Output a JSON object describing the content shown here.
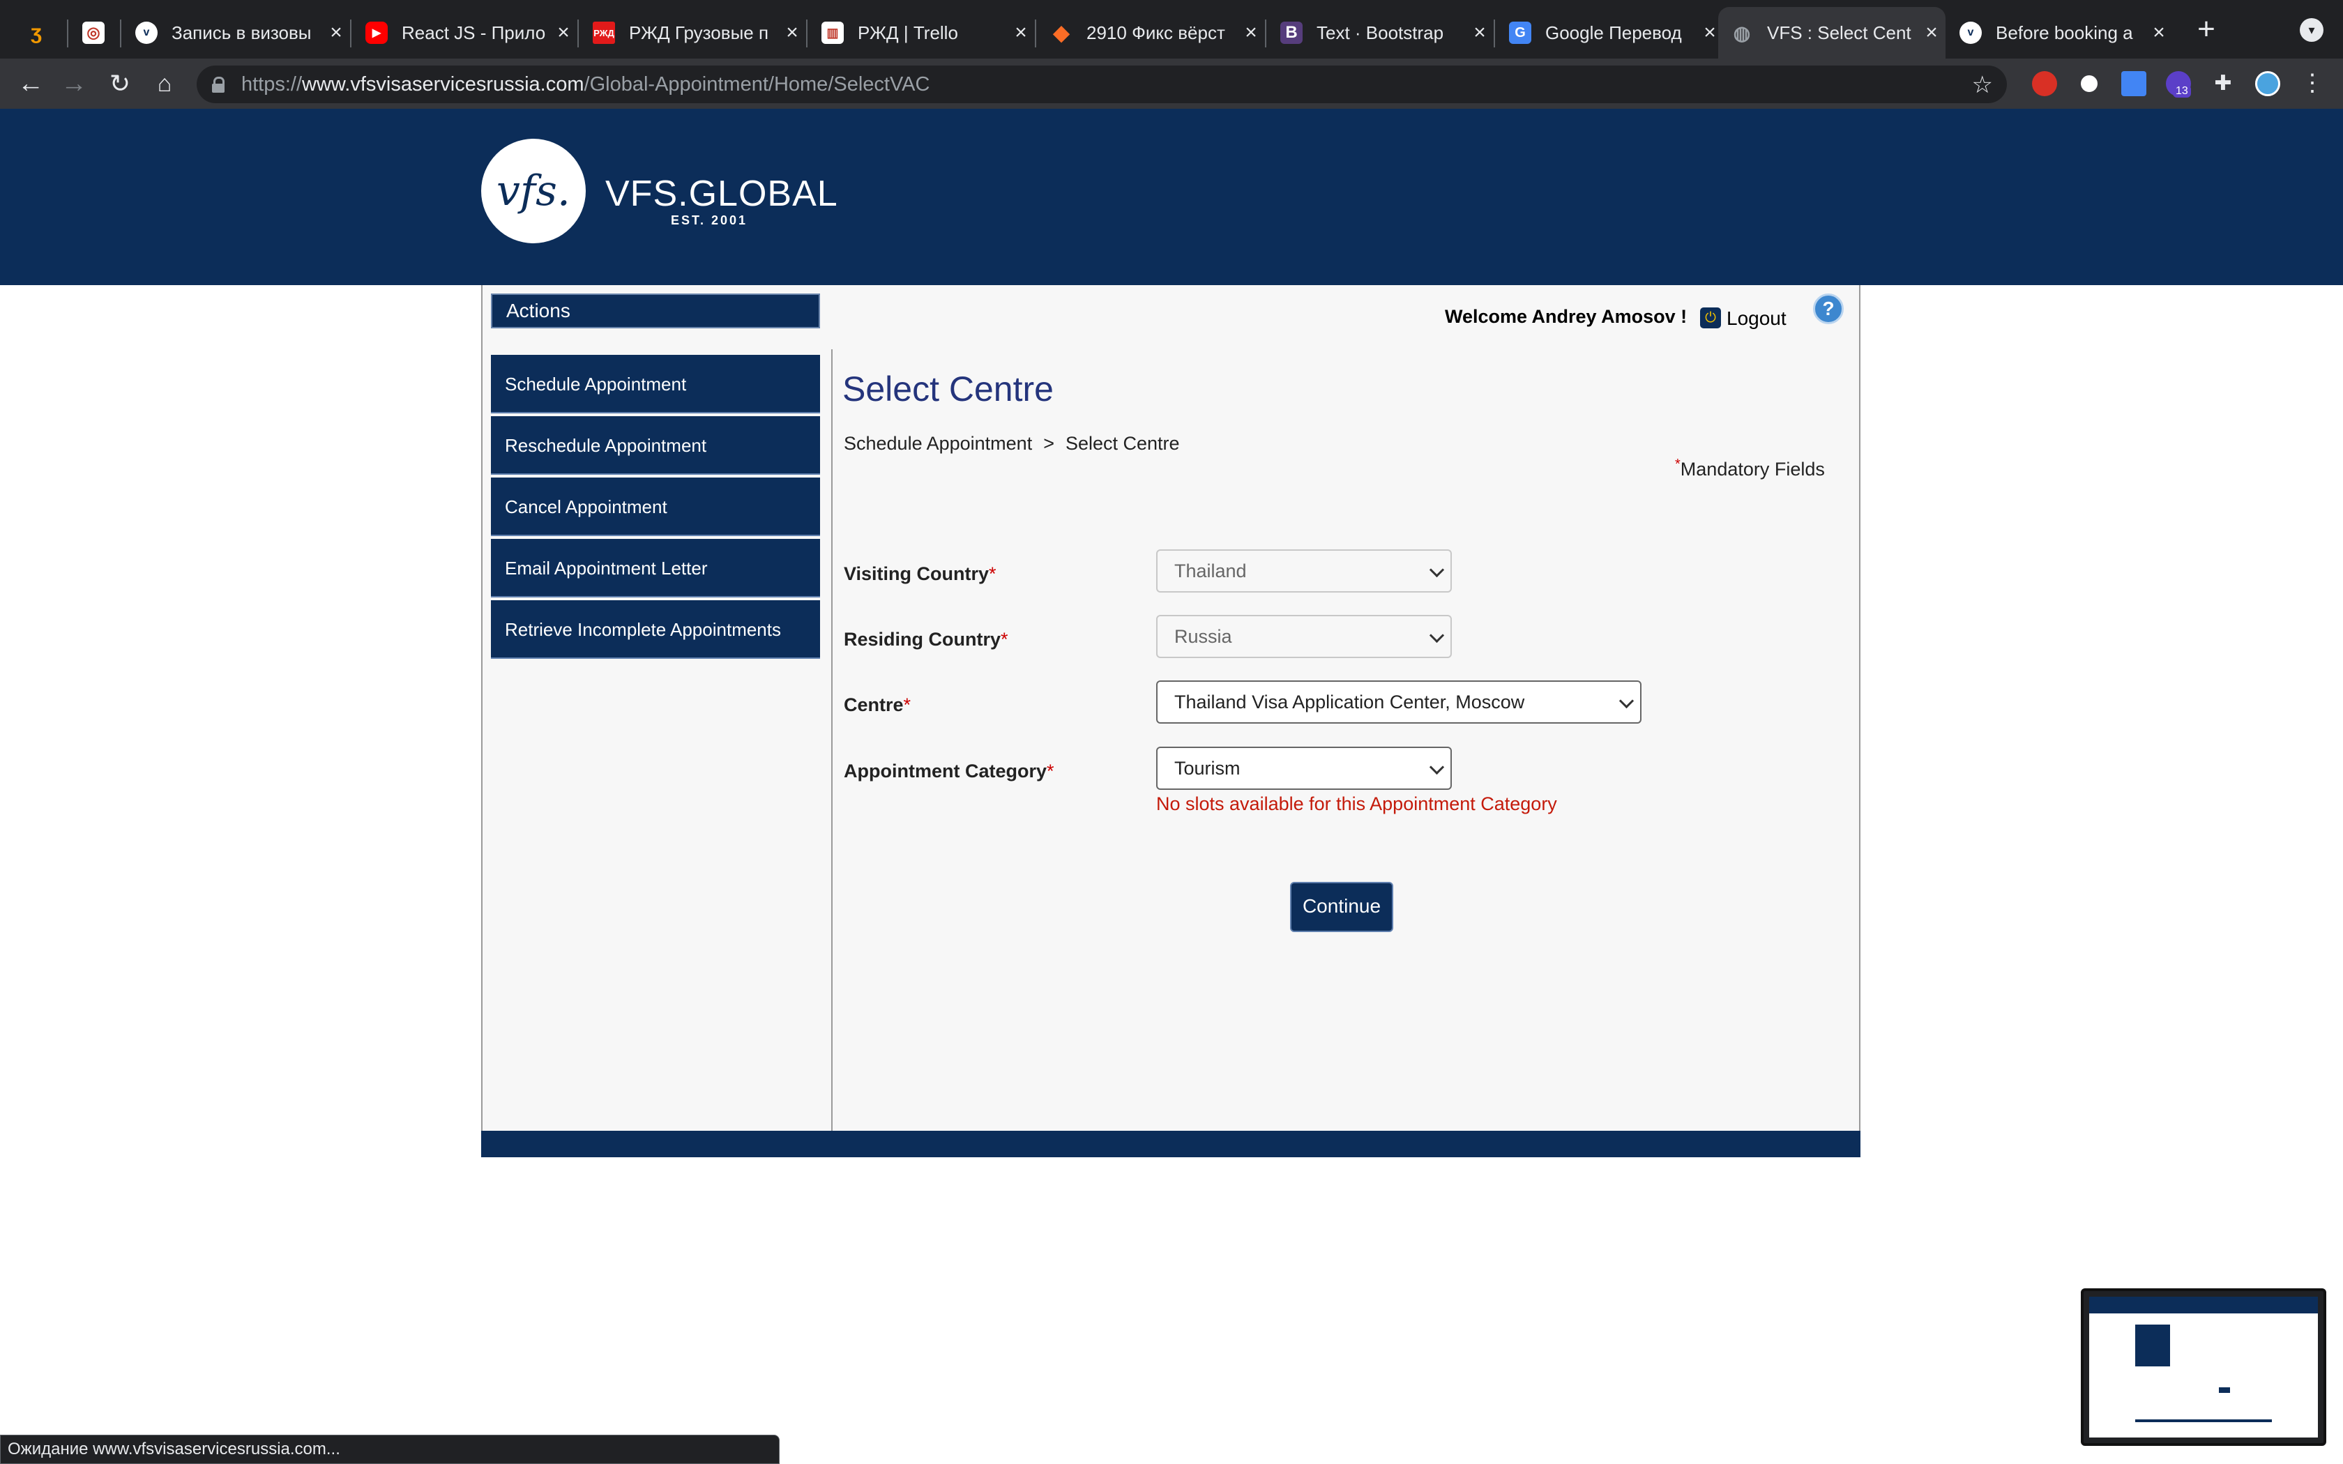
{
  "browser": {
    "tabs": [
      {
        "title": "",
        "icon": "app-icon"
      },
      {
        "title": "",
        "icon": "app-icon-2"
      },
      {
        "title": "Запись в визовы",
        "icon": "vfs-icon"
      },
      {
        "title": "React JS - Прило",
        "icon": "youtube-icon"
      },
      {
        "title": "РЖД Грузовые п",
        "icon": "rzd-icon"
      },
      {
        "title": "РЖД | Trello",
        "icon": "trello-icon"
      },
      {
        "title": "2910 Фикс вёрст",
        "icon": "gitlab-icon"
      },
      {
        "title": "Text · Bootstrap",
        "icon": "bootstrap-icon"
      },
      {
        "title": "Google Перевод",
        "icon": "google-translate-icon"
      },
      {
        "title": "VFS : Select Cent",
        "icon": "globe-icon"
      },
      {
        "title": "Before booking a",
        "icon": "vfs-icon"
      }
    ],
    "new_tab": "+",
    "url_prefix": "https://",
    "url_host": "www.vfsvisaservicesrussia.com",
    "url_path": "/Global-Appointment/Home/SelectVAC",
    "extension_badge": "13",
    "status_text": "Ожидание www.vfsvisaservicesrussia.com..."
  },
  "header": {
    "logo_mark": "vfs.",
    "logo_text": "VFS.GLOBAL",
    "logo_est": "EST. 2001"
  },
  "sidebar": {
    "actions_label": "Actions",
    "items": [
      {
        "label": "Schedule Appointment"
      },
      {
        "label": "Reschedule Appointment"
      },
      {
        "label": "Cancel Appointment"
      },
      {
        "label": "Email Appointment Letter"
      },
      {
        "label": "Retrieve Incomplete Appointments"
      }
    ]
  },
  "user": {
    "welcome": "Welcome Andrey Amosov !",
    "logout": "Logout",
    "help": "?"
  },
  "main": {
    "title": "Select Centre",
    "breadcrumb": [
      "Schedule Appointment",
      ">",
      "Select Centre"
    ],
    "mandatory_marker": "*",
    "mandatory_label": "Mandatory Fields",
    "fields": [
      {
        "label": "Visiting Country",
        "required": "*",
        "value": "Thailand"
      },
      {
        "label": "Residing Country",
        "required": "*",
        "value": "Russia"
      },
      {
        "label": "Centre",
        "required": "*",
        "value": "Thailand Visa Application Center, Moscow"
      },
      {
        "label": "Appointment Category",
        "required": "*",
        "value": "Tourism"
      }
    ],
    "error": "No slots available for this Appointment Category",
    "continue": "Continue"
  },
  "colors": {
    "brand_navy": "#0c2d59",
    "title_blue": "#24347c",
    "error_red": "#c41a0a"
  }
}
